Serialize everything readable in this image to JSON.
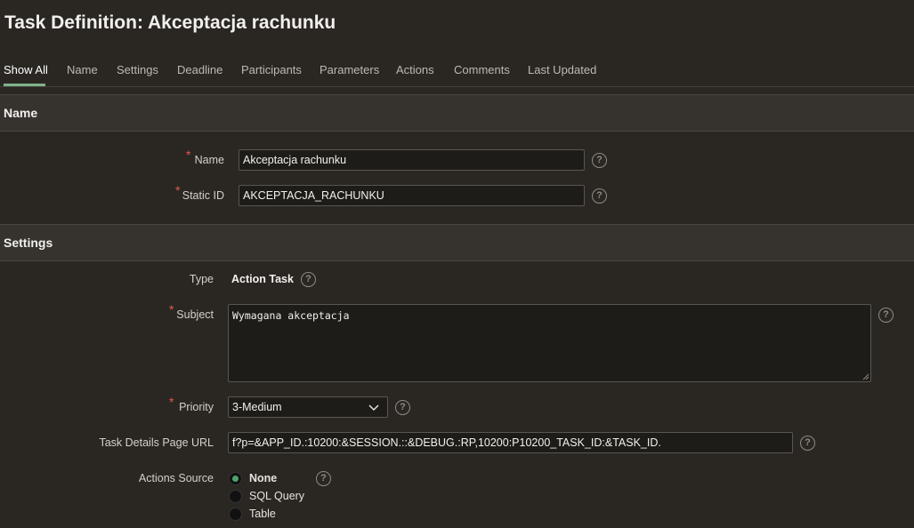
{
  "page": {
    "title": "Task Definition: Akceptacja rachunku"
  },
  "tabs": [
    {
      "label": "Show All"
    },
    {
      "label": "Name"
    },
    {
      "label": "Settings"
    },
    {
      "label": "Deadline"
    },
    {
      "label": "Participants"
    },
    {
      "label": "Parameters"
    },
    {
      "label": "Actions"
    },
    {
      "label": "Comments"
    },
    {
      "label": "Last Updated"
    }
  ],
  "name_region": {
    "heading": "Name",
    "name_label": "Name",
    "name_value": "Akceptacja rachunku",
    "static_id_label": "Static ID",
    "static_id_value": "AKCEPTACJA_RACHUNKU"
  },
  "settings_region": {
    "heading": "Settings",
    "type_label": "Type",
    "type_value": "Action Task",
    "subject_label": "Subject",
    "subject_value": "Wymagana akceptacja",
    "priority_label": "Priority",
    "priority_value": "3-Medium",
    "url_label": "Task Details Page URL",
    "url_value": "f?p=&APP_ID.:10200:&SESSION.::&DEBUG.:RP,10200:P10200_TASK_ID:&TASK_ID.",
    "actions_source_label": "Actions Source",
    "actions_source_options": [
      "None",
      "SQL Query",
      "Table"
    ],
    "actions_source_selected": "None"
  },
  "help_symbol": "?",
  "required_marker": "*",
  "colors": {
    "accent": "#7fb38a",
    "required": "#e05a4a",
    "radio_checked": "#4fa36a"
  }
}
